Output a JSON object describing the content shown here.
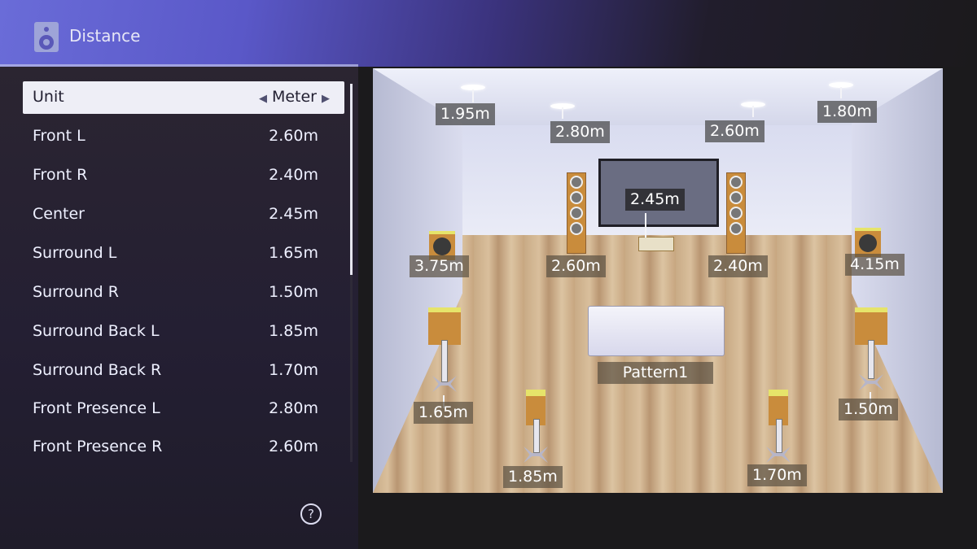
{
  "header": {
    "title": "Distance",
    "icon": "speaker-icon"
  },
  "list": {
    "unit": {
      "label": "Unit",
      "value": "Meter"
    },
    "items": [
      {
        "label": "Front L",
        "value": "2.60m"
      },
      {
        "label": "Front R",
        "value": "2.40m"
      },
      {
        "label": "Center",
        "value": "2.45m"
      },
      {
        "label": "Surround L",
        "value": "1.65m"
      },
      {
        "label": "Surround R",
        "value": "1.50m"
      },
      {
        "label": "Surround Back L",
        "value": "1.85m"
      },
      {
        "label": "Surround Back R",
        "value": "1.70m"
      },
      {
        "label": "Front Presence L",
        "value": "2.80m"
      },
      {
        "label": "Front Presence R",
        "value": "2.60m"
      }
    ],
    "help_glyph": "?"
  },
  "diagram": {
    "pattern_label": "Pattern1",
    "tags": {
      "rear_presence_l": "1.95m",
      "front_presence_l": "2.80m",
      "front_presence_r": "2.60m",
      "rear_presence_r": "1.80m",
      "center": "2.45m",
      "subwoofer_1": "3.75m",
      "front_l": "2.60m",
      "front_r": "2.40m",
      "subwoofer_2": "4.15m",
      "surround_l": "1.65m",
      "surround_r": "1.50m",
      "surround_back_l": "1.85m",
      "surround_back_r": "1.70m"
    }
  }
}
